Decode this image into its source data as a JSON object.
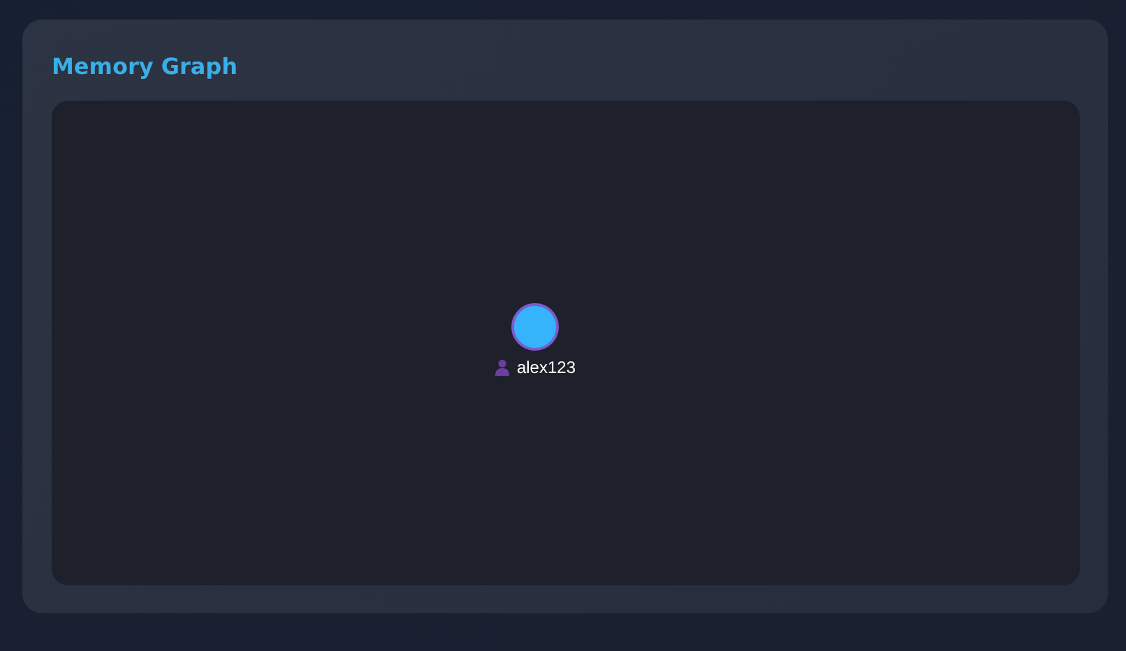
{
  "panel": {
    "title": "Memory Graph"
  },
  "graph": {
    "nodes": [
      {
        "label": "alex123",
        "kind": "user"
      }
    ]
  }
}
